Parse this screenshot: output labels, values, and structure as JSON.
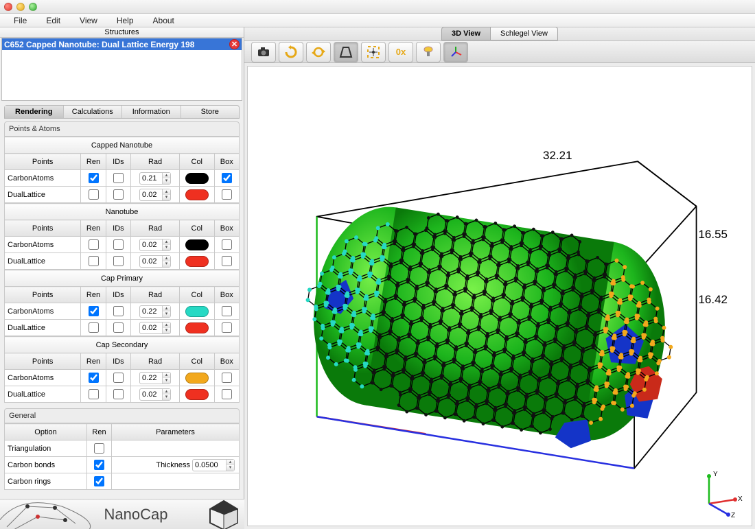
{
  "menu": [
    "File",
    "Edit",
    "View",
    "Help",
    "About"
  ],
  "structures_header": "Structures",
  "structure_item": "C652 Capped Nanotube: Dual Lattice Energy 198",
  "tabs": [
    "Rendering",
    "Calculations",
    "Information",
    "Store"
  ],
  "points_atoms_label": "Points & Atoms",
  "col_headers": {
    "points": "Points",
    "ren": "Ren",
    "ids": "IDs",
    "rad": "Rad",
    "col": "Col",
    "box": "Box"
  },
  "sections": [
    {
      "title": "Capped Nanotube",
      "rows": [
        {
          "name": "CarbonAtoms",
          "ren": true,
          "ids": false,
          "rad": "0.21",
          "col": "#000000",
          "box": true
        },
        {
          "name": "DualLattice",
          "ren": false,
          "ids": false,
          "rad": "0.02",
          "col": "#ef3020",
          "box": false
        }
      ]
    },
    {
      "title": "Nanotube",
      "rows": [
        {
          "name": "CarbonAtoms",
          "ren": false,
          "ids": false,
          "rad": "0.02",
          "col": "#000000",
          "box": false
        },
        {
          "name": "DualLattice",
          "ren": false,
          "ids": false,
          "rad": "0.02",
          "col": "#ef3020",
          "box": false
        }
      ]
    },
    {
      "title": "Cap Primary",
      "rows": [
        {
          "name": "CarbonAtoms",
          "ren": true,
          "ids": false,
          "rad": "0.22",
          "col": "#26d9c4",
          "box": false
        },
        {
          "name": "DualLattice",
          "ren": false,
          "ids": false,
          "rad": "0.02",
          "col": "#ef3020",
          "box": false
        }
      ]
    },
    {
      "title": "Cap Secondary",
      "rows": [
        {
          "name": "CarbonAtoms",
          "ren": true,
          "ids": false,
          "rad": "0.22",
          "col": "#f2a81d",
          "box": false
        },
        {
          "name": "DualLattice",
          "ren": false,
          "ids": false,
          "rad": "0.02",
          "col": "#ef3020",
          "box": false
        }
      ]
    }
  ],
  "general_label": "General",
  "general_cols": {
    "option": "Option",
    "ren": "Ren",
    "params": "Parameters"
  },
  "general_rows": [
    {
      "name": "Triangulation",
      "ren": false,
      "param_label": "",
      "param_val": ""
    },
    {
      "name": "Carbon bonds",
      "ren": true,
      "param_label": "Thickness",
      "param_val": "0.0500"
    },
    {
      "name": "Carbon rings",
      "ren": true,
      "param_label": "",
      "param_val": ""
    }
  ],
  "logo_text": "NanoCap",
  "view_tabs": [
    "3D View",
    "Schlegel View"
  ],
  "dims": {
    "x": "32.21",
    "y": "16.55",
    "z": "16.42"
  },
  "axes": {
    "x": "X",
    "y": "Y",
    "z": "Z"
  },
  "toolbar_icons": [
    "camera",
    "rotate-ccw",
    "rotate-sync",
    "perspective",
    "center",
    "zero-x",
    "light",
    "axes"
  ]
}
